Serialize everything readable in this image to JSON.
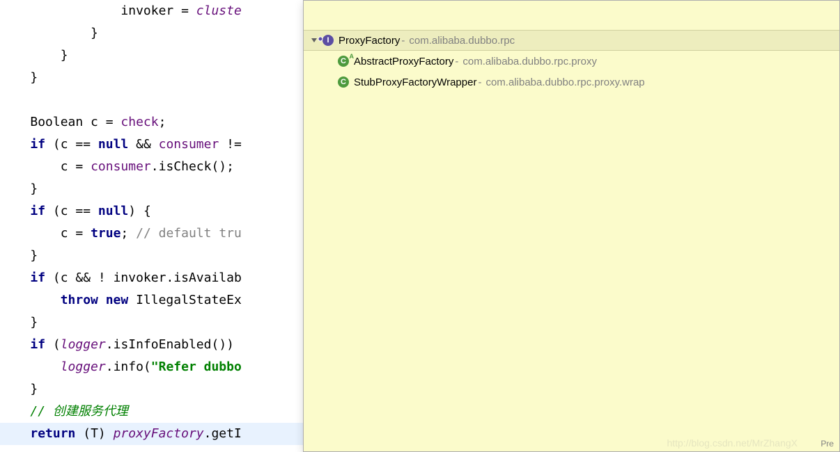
{
  "code": {
    "lines": [
      {
        "indent": 16,
        "tokens": [
          {
            "t": "invoker = ",
            "c": "black"
          },
          {
            "t": "cluste",
            "c": "italic-ident"
          }
        ]
      },
      {
        "indent": 12,
        "tokens": [
          {
            "t": "}",
            "c": "black"
          }
        ]
      },
      {
        "indent": 8,
        "tokens": [
          {
            "t": "}",
            "c": "black"
          }
        ]
      },
      {
        "indent": 4,
        "tokens": [
          {
            "t": "}",
            "c": "black"
          }
        ]
      },
      {
        "indent": 4,
        "tokens": []
      },
      {
        "indent": 4,
        "tokens": [
          {
            "t": "Boolean c = ",
            "c": "black"
          },
          {
            "t": "check",
            "c": "field"
          },
          {
            "t": ";",
            "c": "black"
          }
        ]
      },
      {
        "indent": 4,
        "tokens": [
          {
            "t": "if",
            "c": "kw"
          },
          {
            "t": " (c == ",
            "c": "black"
          },
          {
            "t": "null",
            "c": "kw"
          },
          {
            "t": " && ",
            "c": "black"
          },
          {
            "t": "consumer",
            "c": "field"
          },
          {
            "t": " !=",
            "c": "black"
          }
        ]
      },
      {
        "indent": 8,
        "tokens": [
          {
            "t": "c = ",
            "c": "black"
          },
          {
            "t": "consumer",
            "c": "field"
          },
          {
            "t": ".isCheck();",
            "c": "black"
          }
        ]
      },
      {
        "indent": 4,
        "tokens": [
          {
            "t": "}",
            "c": "black"
          }
        ]
      },
      {
        "indent": 4,
        "tokens": [
          {
            "t": "if",
            "c": "kw"
          },
          {
            "t": " (c == ",
            "c": "black"
          },
          {
            "t": "null",
            "c": "kw"
          },
          {
            "t": ") {",
            "c": "black"
          }
        ]
      },
      {
        "indent": 8,
        "tokens": [
          {
            "t": "c = ",
            "c": "black"
          },
          {
            "t": "true",
            "c": "kw"
          },
          {
            "t": "; ",
            "c": "black"
          },
          {
            "t": "// default tru",
            "c": "comment"
          }
        ]
      },
      {
        "indent": 4,
        "tokens": [
          {
            "t": "}",
            "c": "black"
          }
        ]
      },
      {
        "indent": 4,
        "tokens": [
          {
            "t": "if",
            "c": "kw"
          },
          {
            "t": " (c && ! invoker.isAvailab",
            "c": "black"
          }
        ]
      },
      {
        "indent": 8,
        "tokens": [
          {
            "t": "throw new",
            "c": "kw"
          },
          {
            "t": " IllegalStateEx",
            "c": "black"
          }
        ]
      },
      {
        "indent": 4,
        "tokens": [
          {
            "t": "}",
            "c": "black"
          }
        ]
      },
      {
        "indent": 4,
        "tokens": [
          {
            "t": "if",
            "c": "kw"
          },
          {
            "t": " (",
            "c": "black"
          },
          {
            "t": "logger",
            "c": "italic-ident"
          },
          {
            "t": ".isInfoEnabled())",
            "c": "black"
          }
        ]
      },
      {
        "indent": 8,
        "tokens": [
          {
            "t": "logger",
            "c": "italic-ident"
          },
          {
            "t": ".info(",
            "c": "black"
          },
          {
            "t": "\"Refer dubbo",
            "c": "string"
          }
        ]
      },
      {
        "indent": 4,
        "tokens": [
          {
            "t": "}",
            "c": "black"
          }
        ]
      },
      {
        "indent": 4,
        "tokens": [
          {
            "t": "// 创建服务代理",
            "c": "comment-green"
          }
        ]
      },
      {
        "indent": 4,
        "highlight": true,
        "tokens": [
          {
            "t": "return",
            "c": "kw"
          },
          {
            "t": " (T) ",
            "c": "black"
          },
          {
            "t": "proxyFactory",
            "c": "italic-ident"
          },
          {
            "t": ".getI",
            "c": "black"
          }
        ]
      }
    ]
  },
  "popup": {
    "root": {
      "name": "ProxyFactory",
      "pkg": "com.alibaba.dubbo.rpc",
      "icon": "interface"
    },
    "children": [
      {
        "name": "AbstractProxyFactory",
        "pkg": "com.alibaba.dubbo.rpc.proxy",
        "icon": "class",
        "abstract": true
      },
      {
        "name": "StubProxyFactoryWrapper",
        "pkg": "com.alibaba.dubbo.rpc.proxy.wrap",
        "icon": "class",
        "abstract": false
      }
    ],
    "footer": "Pre",
    "watermark": "http://blog.csdn.net/MrZhangX"
  }
}
